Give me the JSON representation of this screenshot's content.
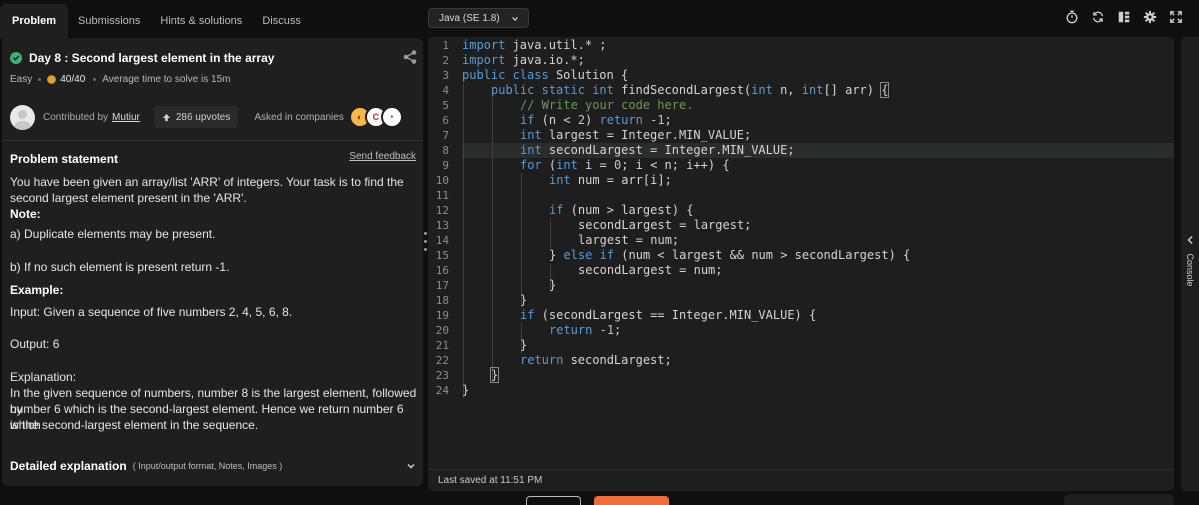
{
  "tabs": [
    {
      "label": "Problem",
      "active": true
    },
    {
      "label": "Submissions",
      "active": false
    },
    {
      "label": "Hints & solutions",
      "active": false
    },
    {
      "label": "Discuss",
      "active": false
    }
  ],
  "problem": {
    "title": "Day 8 : Second largest element in the array",
    "difficulty": "Easy",
    "score": "40/40",
    "avg_time": "Average time to solve is 15m",
    "contributed_by_label": "Contributed by",
    "contributor": "Mutiur",
    "upvotes": "286 upvotes",
    "asked_in": "Asked in companies",
    "statement_heading": "Problem statement",
    "send_feedback": "Send feedback",
    "statement_line1": "You have been given an array/list 'ARR' of integers. Your task is to find the",
    "statement_line2": "second largest element present in the 'ARR'.",
    "note_heading": "Note:",
    "note_a": "a) Duplicate elements may be present.",
    "note_b": "b) If no such element is present return -1.",
    "example_heading": "Example:",
    "example_input": "Input: Given a sequence of five numbers 2, 4, 5, 6, 8.",
    "example_output": "Output:  6",
    "explanation_heading": "Explanation:",
    "explanation_1": "In the given sequence of numbers, number 8 is the largest element, followed by",
    "explanation_2": "number 6 which is the second-largest element. Hence we return number 6 which",
    "explanation_3": "is the second-largest element in the sequence.",
    "detailed_heading": "Detailed explanation",
    "detailed_sub": "( Input/output format, Notes, Images )"
  },
  "editor": {
    "language": "Java (SE 1.8)",
    "last_saved": "Last saved at 11:51 PM",
    "console_label": "Console",
    "highlighted_line": 8,
    "lines": [
      {
        "n": "1",
        "indent": 0,
        "html": "<span class='kw'>import</span> java.util.* ;"
      },
      {
        "n": "2",
        "indent": 0,
        "html": "<span class='kw'>import</span> java.io.*;"
      },
      {
        "n": "3",
        "indent": 0,
        "html": "<span class='kw'>public</span> <span class='kw'>class</span> Solution {"
      },
      {
        "n": "4",
        "indent": 1,
        "html": "<span class='kw'>public</span> <span class='kw'>static</span> <span class='kw'>int</span> findSecondLargest(<span class='kw'>int</span> n, <span class='kw'>int</span>[] arr) <span class='brk'>{</span>"
      },
      {
        "n": "5",
        "indent": 2,
        "html": "<span class='cm'>// Write your code here.</span>"
      },
      {
        "n": "6",
        "indent": 2,
        "html": "<span class='kw'>if</span> (n &lt; <span class='num'>2</span>) <span class='kw'>return</span> <span class='num'>-1</span>;"
      },
      {
        "n": "7",
        "indent": 2,
        "html": "<span class='kw'>int</span> largest = Integer.MIN_VALUE;"
      },
      {
        "n": "8",
        "indent": 2,
        "html": "<span class='kw'>int</span> secondLargest = Integer.MIN_VALUE;"
      },
      {
        "n": "9",
        "indent": 2,
        "html": "<span class='kw'>for</span> (<span class='kw'>int</span> i = <span class='num'>0</span>; i &lt; n; i++) {"
      },
      {
        "n": "10",
        "indent": 3,
        "html": "<span class='kw'>int</span> num = arr[i];"
      },
      {
        "n": "11",
        "indent": 0,
        "html": ""
      },
      {
        "n": "12",
        "indent": 3,
        "html": "<span class='kw'>if</span> (num &gt; largest) {"
      },
      {
        "n": "13",
        "indent": 4,
        "html": "secondLargest = largest;"
      },
      {
        "n": "14",
        "indent": 4,
        "html": "largest = num;"
      },
      {
        "n": "15",
        "indent": 3,
        "html": "} <span class='kw'>else</span> <span class='kw'>if</span> (num &lt; largest &amp;&amp; num &gt; secondLargest) {"
      },
      {
        "n": "16",
        "indent": 4,
        "html": "secondLargest = num;"
      },
      {
        "n": "17",
        "indent": 3,
        "html": "}"
      },
      {
        "n": "18",
        "indent": 2,
        "html": "}"
      },
      {
        "n": "19",
        "indent": 2,
        "html": "<span class='kw'>if</span> (secondLargest == Integer.MIN_VALUE) {"
      },
      {
        "n": "20",
        "indent": 3,
        "html": "<span class='kw'>return</span> <span class='num'>-1</span>;"
      },
      {
        "n": "21",
        "indent": 2,
        "html": "}"
      },
      {
        "n": "22",
        "indent": 2,
        "html": "<span class='kw'>return</span> secondLargest;"
      },
      {
        "n": "23",
        "indent": 1,
        "html": "<span class='brk'>}</span>"
      },
      {
        "n": "24",
        "indent": 0,
        "html": "}"
      }
    ]
  },
  "colors": {
    "accent_orange": "#f26b3a",
    "success_green": "#3cb371",
    "keyword_blue": "#569cd6",
    "comment_green": "#6a9955"
  },
  "icons": [
    "check-circle-icon",
    "share-icon",
    "coin-icon",
    "upvote-arrow-icon",
    "chevron-down-icon",
    "timer-icon",
    "reset-icon",
    "layout-icon",
    "settings-icon",
    "fullscreen-icon",
    "chevron-left-icon"
  ]
}
